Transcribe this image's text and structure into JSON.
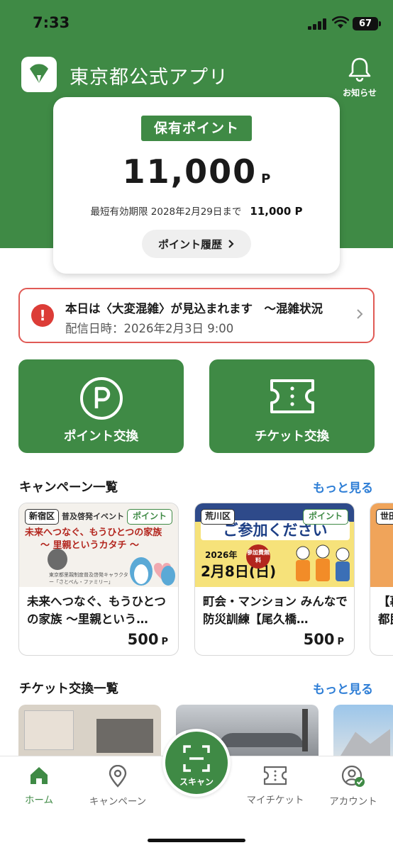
{
  "status_bar": {
    "time": "7:33",
    "battery": "67"
  },
  "header": {
    "title": "東京都公式アプリ",
    "notice_label": "お知らせ"
  },
  "points": {
    "tag": "保有ポイント",
    "value": "11,000",
    "unit": "P",
    "expiry_label": "最短有効期限 2028年2月29日まで",
    "expiry_amount": "11,000 P",
    "history_button": "ポイント履歴"
  },
  "alert": {
    "title": "本日は〈大変混雑〉が見込まれます　～混雑状況",
    "date": "配信日時：2026年2月3日 9:00"
  },
  "actions": [
    {
      "label": "ポイント交換",
      "icon": "p-circle-icon"
    },
    {
      "label": "チケット交換",
      "icon": "ticket-icon"
    }
  ],
  "campaigns": {
    "title": "キャンペーン一覧",
    "more": "もっと見る",
    "items": [
      {
        "area": "新宿区",
        "badge": "ポイント",
        "banner_top": "普及啓発イベント",
        "banner_headline": "未来へつなぐ、もうひとつの家族",
        "banner_sub": "～ 里親というカタチ ～",
        "banner_caption": "東京都里親制度普及啓発キャラクター「さとぺん・ファミリー」",
        "title": "未来へつなぐ、もうひとつの家族 ～里親という…",
        "price": "500",
        "unit": "P"
      },
      {
        "area": "荒川区",
        "badge": "ポイント",
        "banner_headline": "ご参加ください",
        "banner_year": "2026年",
        "banner_date": "2月8日(日)",
        "banner_free": "参加費無料",
        "title": "町会・マンション みんなで防災訓練【尾久橋…",
        "price": "500",
        "unit": "P"
      },
      {
        "area": "世田",
        "title": "【暮 都民",
        "price": "",
        "unit": ""
      }
    ]
  },
  "tickets": {
    "title": "チケット交換一覧",
    "more": "もっと見る"
  },
  "tab_bar": {
    "home": "ホーム",
    "campaign": "キャンペーン",
    "scan": "スキャン",
    "my_ticket": "マイチケット",
    "account": "アカウント"
  },
  "colors": {
    "brand_green": "#3f8a45",
    "alert_red": "#dc3c37",
    "link_blue": "#2e7ed6"
  }
}
